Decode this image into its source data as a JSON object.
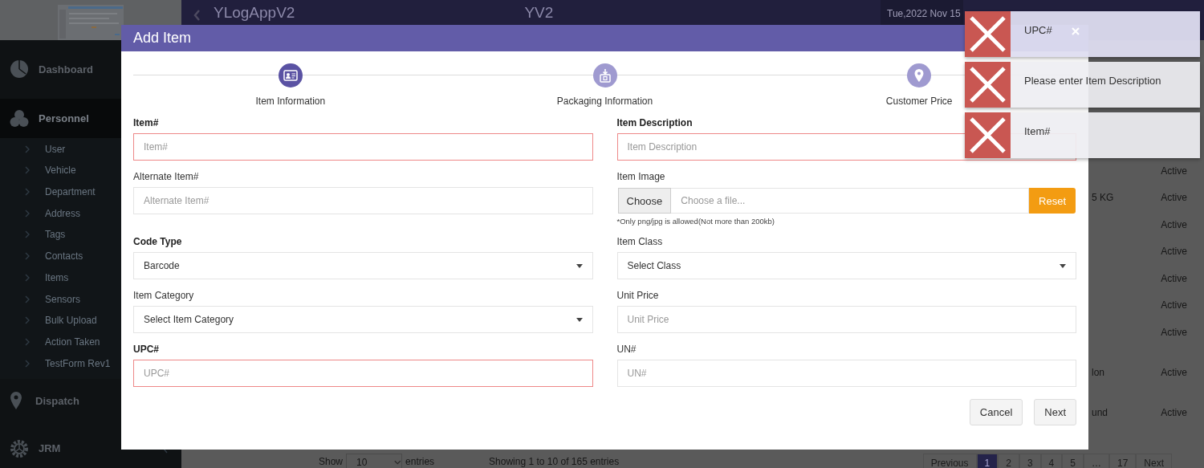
{
  "sidebar": {
    "items": [
      {
        "label": "Dashboard",
        "expanded": false
      },
      {
        "label": "Personnel",
        "expanded": true,
        "children": [
          {
            "label": "User"
          },
          {
            "label": "Vehicle"
          },
          {
            "label": "Department"
          },
          {
            "label": "Address"
          },
          {
            "label": "Tags"
          },
          {
            "label": "Contacts"
          },
          {
            "label": "Items"
          },
          {
            "label": "Sensors"
          },
          {
            "label": "Bulk Upload"
          },
          {
            "label": "Action Taken"
          },
          {
            "label": "TestForm Rev1"
          }
        ]
      },
      {
        "label": "Dispatch",
        "expanded": false
      },
      {
        "label": "JRM",
        "expanded": false
      }
    ]
  },
  "header": {
    "app_title": "YLogAppV2",
    "subtitle": "YV2",
    "date": "Tue,2022 Nov 15"
  },
  "table": {
    "rows": [
      {
        "status": "Active"
      },
      {
        "cell": "5 KG",
        "status": "Active"
      },
      {
        "status": "Active"
      },
      {
        "status": "Active"
      },
      {
        "status": "Active"
      },
      {
        "status": "Active"
      },
      {
        "status": "Active"
      },
      {
        "cell": "lon",
        "status": "Active"
      },
      {
        "cell": "und",
        "status": "Active"
      }
    ]
  },
  "footer": {
    "show_label": "Show",
    "page_size": "10",
    "entries_label": "entries",
    "info": "Showing 1 to 10 of 165 entries",
    "pages": [
      {
        "label": "Previous",
        "selected": false
      },
      {
        "label": "1",
        "selected": true
      },
      {
        "label": "2",
        "selected": false
      },
      {
        "label": "3",
        "selected": false
      },
      {
        "label": "4",
        "selected": false
      },
      {
        "label": "5",
        "selected": false
      },
      {
        "label": "…",
        "selected": false
      },
      {
        "label": "17",
        "selected": false
      },
      {
        "label": "Next",
        "selected": false
      }
    ]
  },
  "modal": {
    "title": "Add Item",
    "steps": [
      {
        "label": "Item Information",
        "selected": true
      },
      {
        "label": "Packaging Information",
        "selected": false
      },
      {
        "label": "Customer Price",
        "selected": false
      }
    ],
    "fields": [
      {
        "label": "Item#",
        "kind": "text",
        "placeholder": "Item#",
        "required": true,
        "invalid": true
      },
      {
        "label": "Item Description",
        "kind": "text",
        "placeholder": "Item Description",
        "required": true,
        "invalid": true
      },
      {
        "label": "Alternate Item#",
        "kind": "text",
        "placeholder": "Alternate Item#",
        "required": false,
        "invalid": false
      },
      {
        "label": "Item Image",
        "kind": "file",
        "button": "Choose",
        "placeholder": "Choose a file...",
        "reset": "Reset",
        "note": "*Only png/jpg is allowed(Not more than 200kb)",
        "required": false,
        "invalid": false
      },
      {
        "label": "Code Type",
        "kind": "select",
        "value": "Barcode",
        "required": true,
        "invalid": false
      },
      {
        "label": "Item Class",
        "kind": "select",
        "value": "Select Class",
        "required": false,
        "invalid": false
      },
      {
        "label": "Item Category",
        "kind": "select",
        "value": "Select Item Category",
        "required": false,
        "invalid": false
      },
      {
        "label": "Unit Price",
        "kind": "text",
        "placeholder": "Unit Price",
        "required": false,
        "invalid": false
      },
      {
        "label": "UPC#",
        "kind": "text",
        "placeholder": "UPC#",
        "required": true,
        "invalid": true
      },
      {
        "label": "UN#",
        "kind": "text",
        "placeholder": "UN#",
        "required": false,
        "invalid": false
      }
    ],
    "buttons": [
      {
        "label": "Cancel"
      },
      {
        "label": "Next"
      }
    ]
  },
  "toasts": [
    {
      "message": "UPC#",
      "closable": true
    },
    {
      "message": "Please enter Item Description",
      "closable": false
    },
    {
      "message": "Item#",
      "closable": false
    }
  ]
}
